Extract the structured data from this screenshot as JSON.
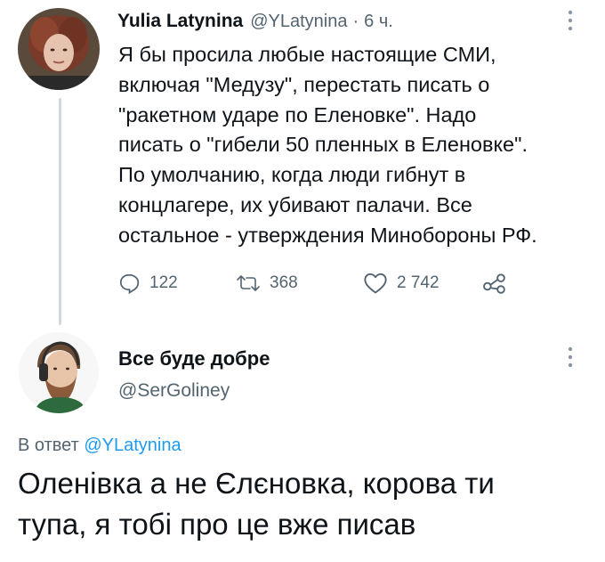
{
  "original_tweet": {
    "author_name": "Yulia Latynina",
    "author_handle": "@YLatynina",
    "separator": "·",
    "time": "6 ч.",
    "text_lines": [
      "Я бы просила любые настоящие СМИ,",
      "включая \"Медузу\", перестать писать о",
      "\"ракетном ударе по Еленовке\". Надо",
      "писать о \"гибели 50 пленных  в Еленовке\".",
      "По умолчанию, когда люди гибнут в",
      "концлагере, их убивают палачи. Все",
      "остальное - утверждения Минобороны РФ."
    ],
    "stats": {
      "replies": "122",
      "retweets": "368",
      "likes": "2 742"
    },
    "icons": [
      "reply-icon",
      "retweet-icon",
      "like-icon",
      "share-icon",
      "more-icon"
    ]
  },
  "reply_tweet": {
    "author_name": "Все буде добре",
    "author_handle": "@SerGoliney",
    "reply_prefix": "В ответ",
    "reply_mention": "@YLatynina",
    "text_lines": [
      "Оленівка а не Єлєновка, корова ти",
      "тупа, я тобі про це вже писав"
    ]
  },
  "colors": {
    "text": "#0f1419",
    "secondary": "#536471",
    "link": "#1d9bf0",
    "thread_line": "#cfd9de"
  }
}
